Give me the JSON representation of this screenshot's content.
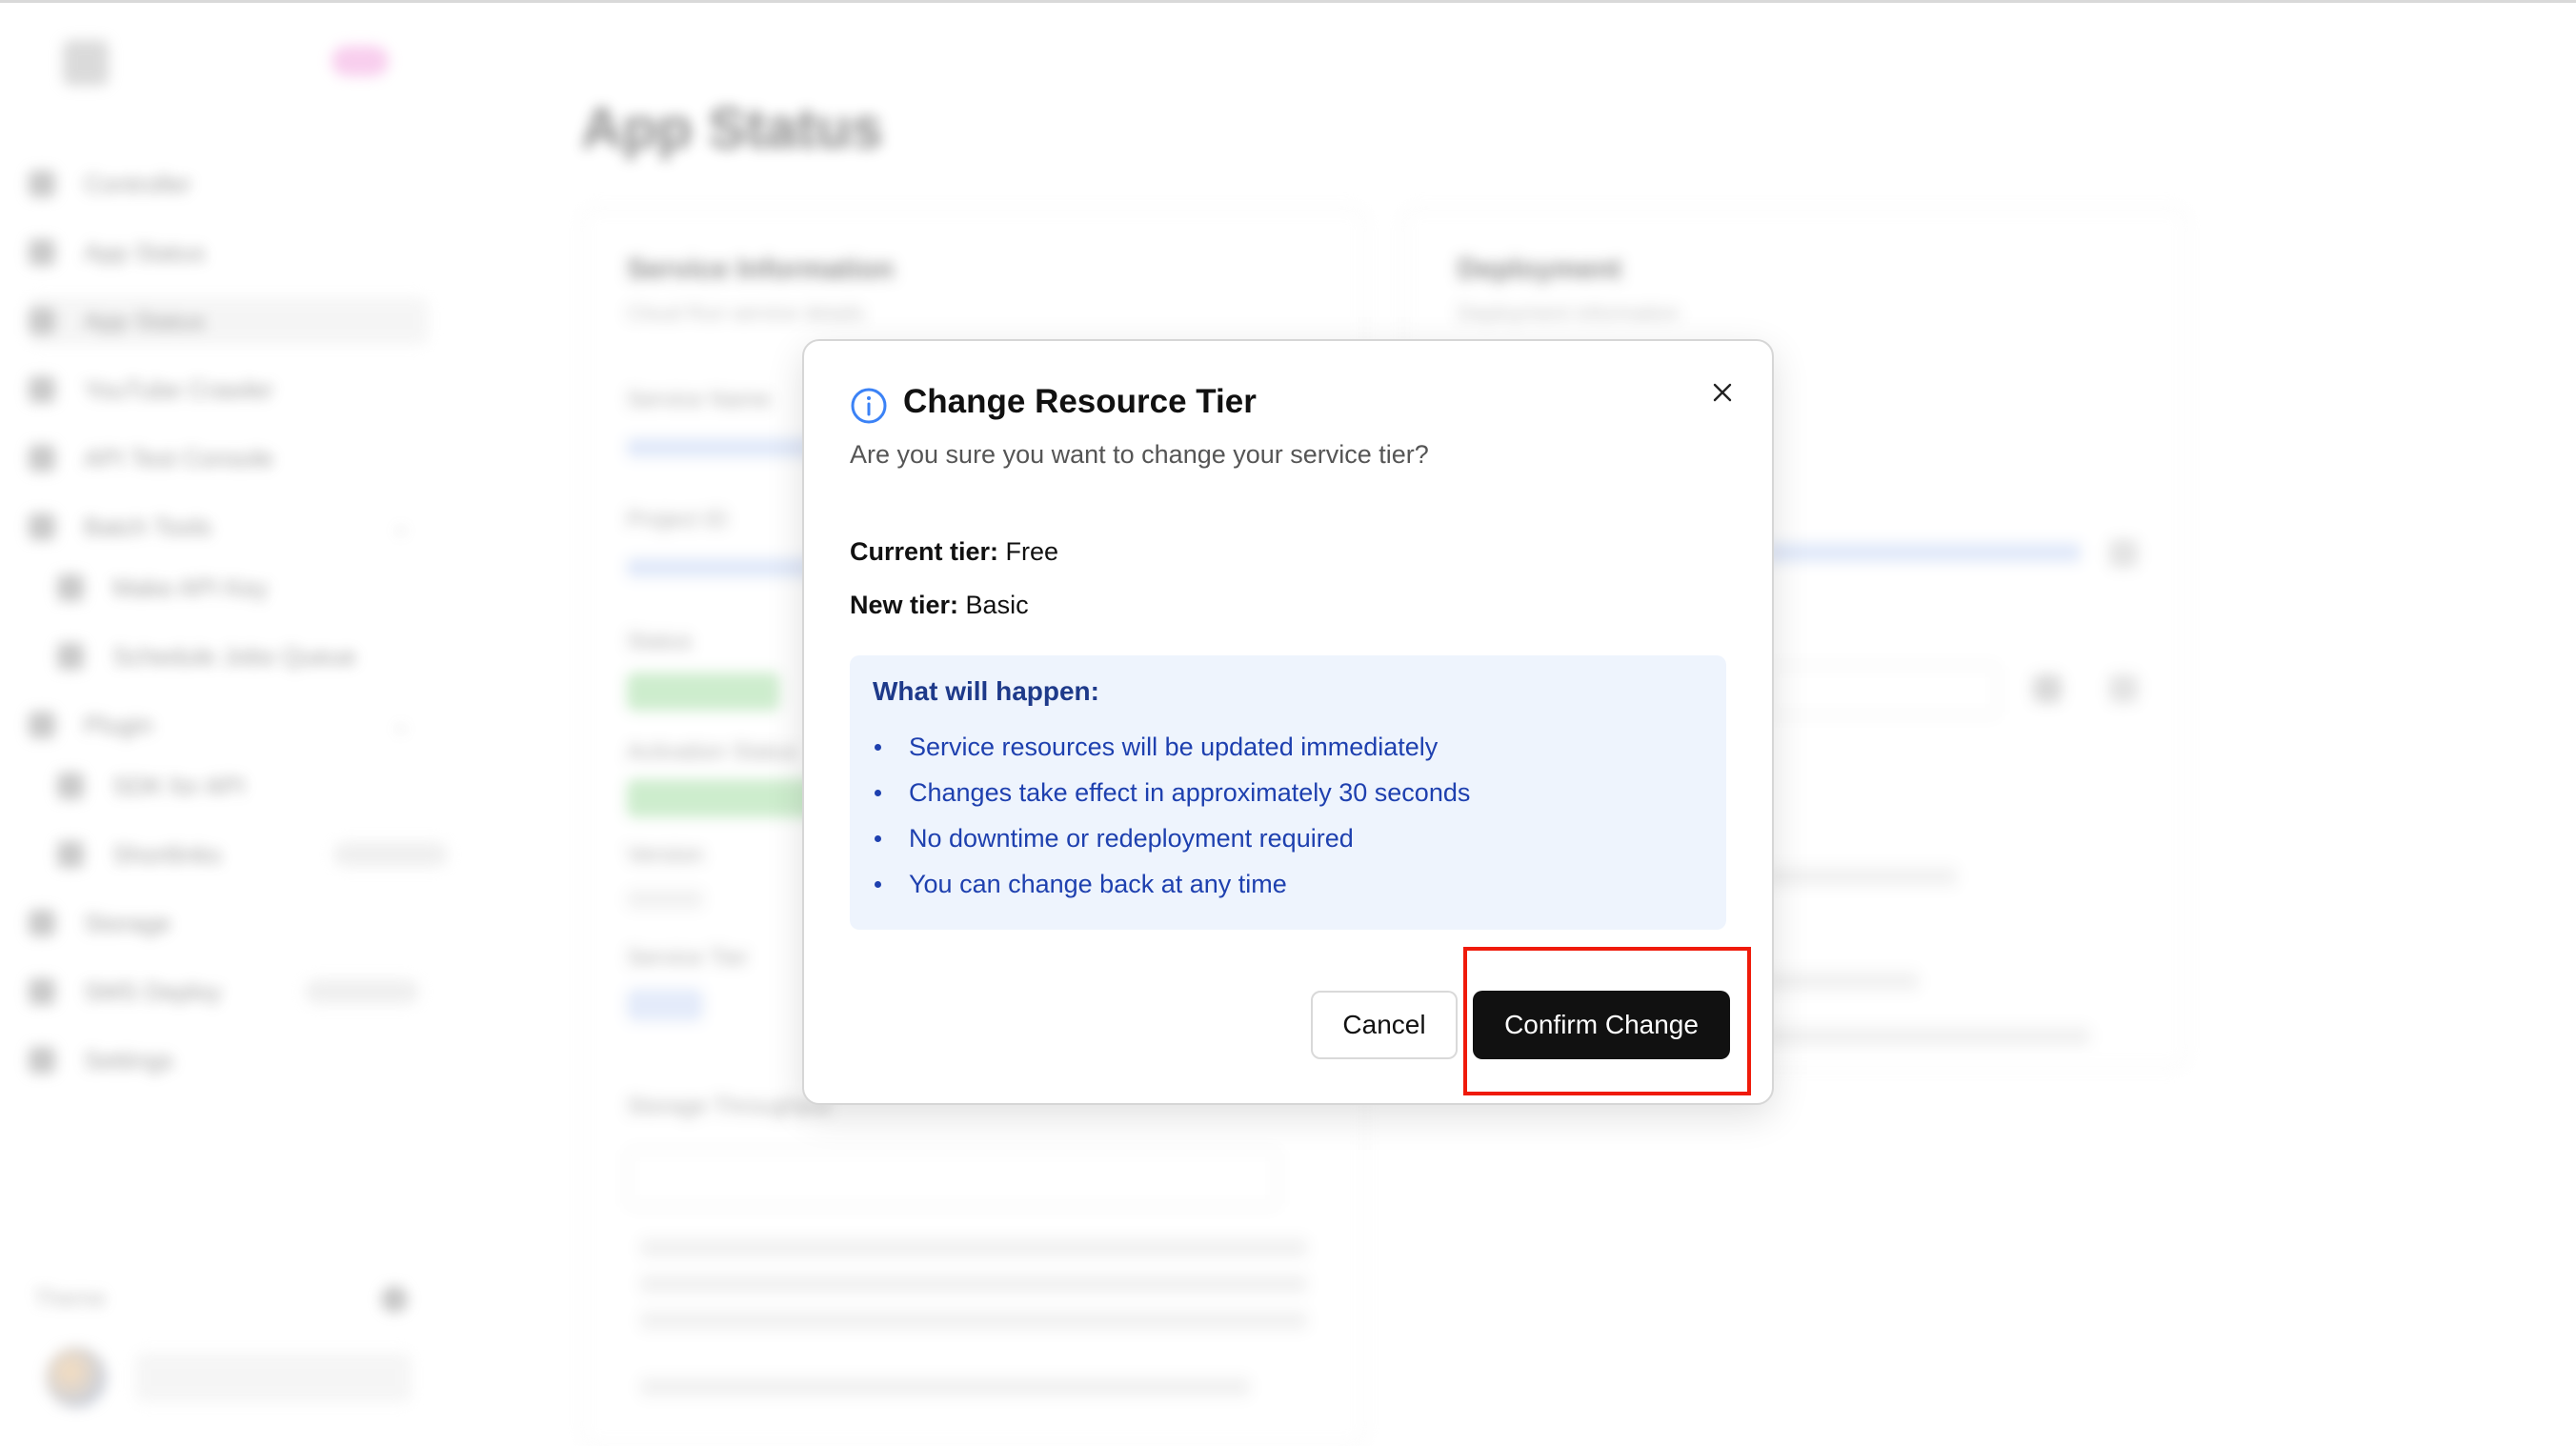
{
  "colors": {
    "accent": "#111111",
    "info_blue": "#1e40af",
    "info_box_bg": "#eef4fd",
    "highlight": "#ef1a0a",
    "icon_blue": "#3b82f6"
  },
  "background": {
    "page_title": "App Status",
    "sidebar": {
      "items": [
        {
          "label": "Controller"
        },
        {
          "label": "App Status"
        },
        {
          "label": "App Status"
        },
        {
          "label": "YouTube Crawler"
        },
        {
          "label": "API Test Console"
        },
        {
          "label": "Batch Tools"
        },
        {
          "label": "Make API Key"
        },
        {
          "label": "Schedule Jobs Queue"
        },
        {
          "label": "Plugin"
        },
        {
          "label": "SDK for API"
        },
        {
          "label": "Shortlinks"
        },
        {
          "label": "Storage"
        },
        {
          "label": "SMS Deploy"
        },
        {
          "label": "Settings"
        }
      ],
      "theme_label": "Theme"
    },
    "service_panel": {
      "title": "Service Information",
      "subtitle": "Cloud Run service details",
      "rows": [
        "Service Name",
        "Project ID",
        "Status",
        "Activation Status",
        "Version",
        "Service Tier",
        "Storage Throughput"
      ]
    },
    "deployment_panel": {
      "title": "Deployment",
      "subtitle": "Deployment information"
    }
  },
  "modal": {
    "title": "Change Resource Tier",
    "subtitle": "Are you sure you want to change your service tier?",
    "current_tier_label": "Current tier:",
    "current_tier_value": "Free",
    "new_tier_label": "New tier:",
    "new_tier_value": "Basic",
    "info_title": "What will happen:",
    "info_items": [
      "Service resources will be updated immediately",
      "Changes take effect in approximately 30 seconds",
      "No downtime or redeployment required",
      "You can change back at any time"
    ],
    "cancel_label": "Cancel",
    "confirm_label": "Confirm Change",
    "icons": {
      "info": "info-circle-icon",
      "close": "close-icon"
    }
  }
}
